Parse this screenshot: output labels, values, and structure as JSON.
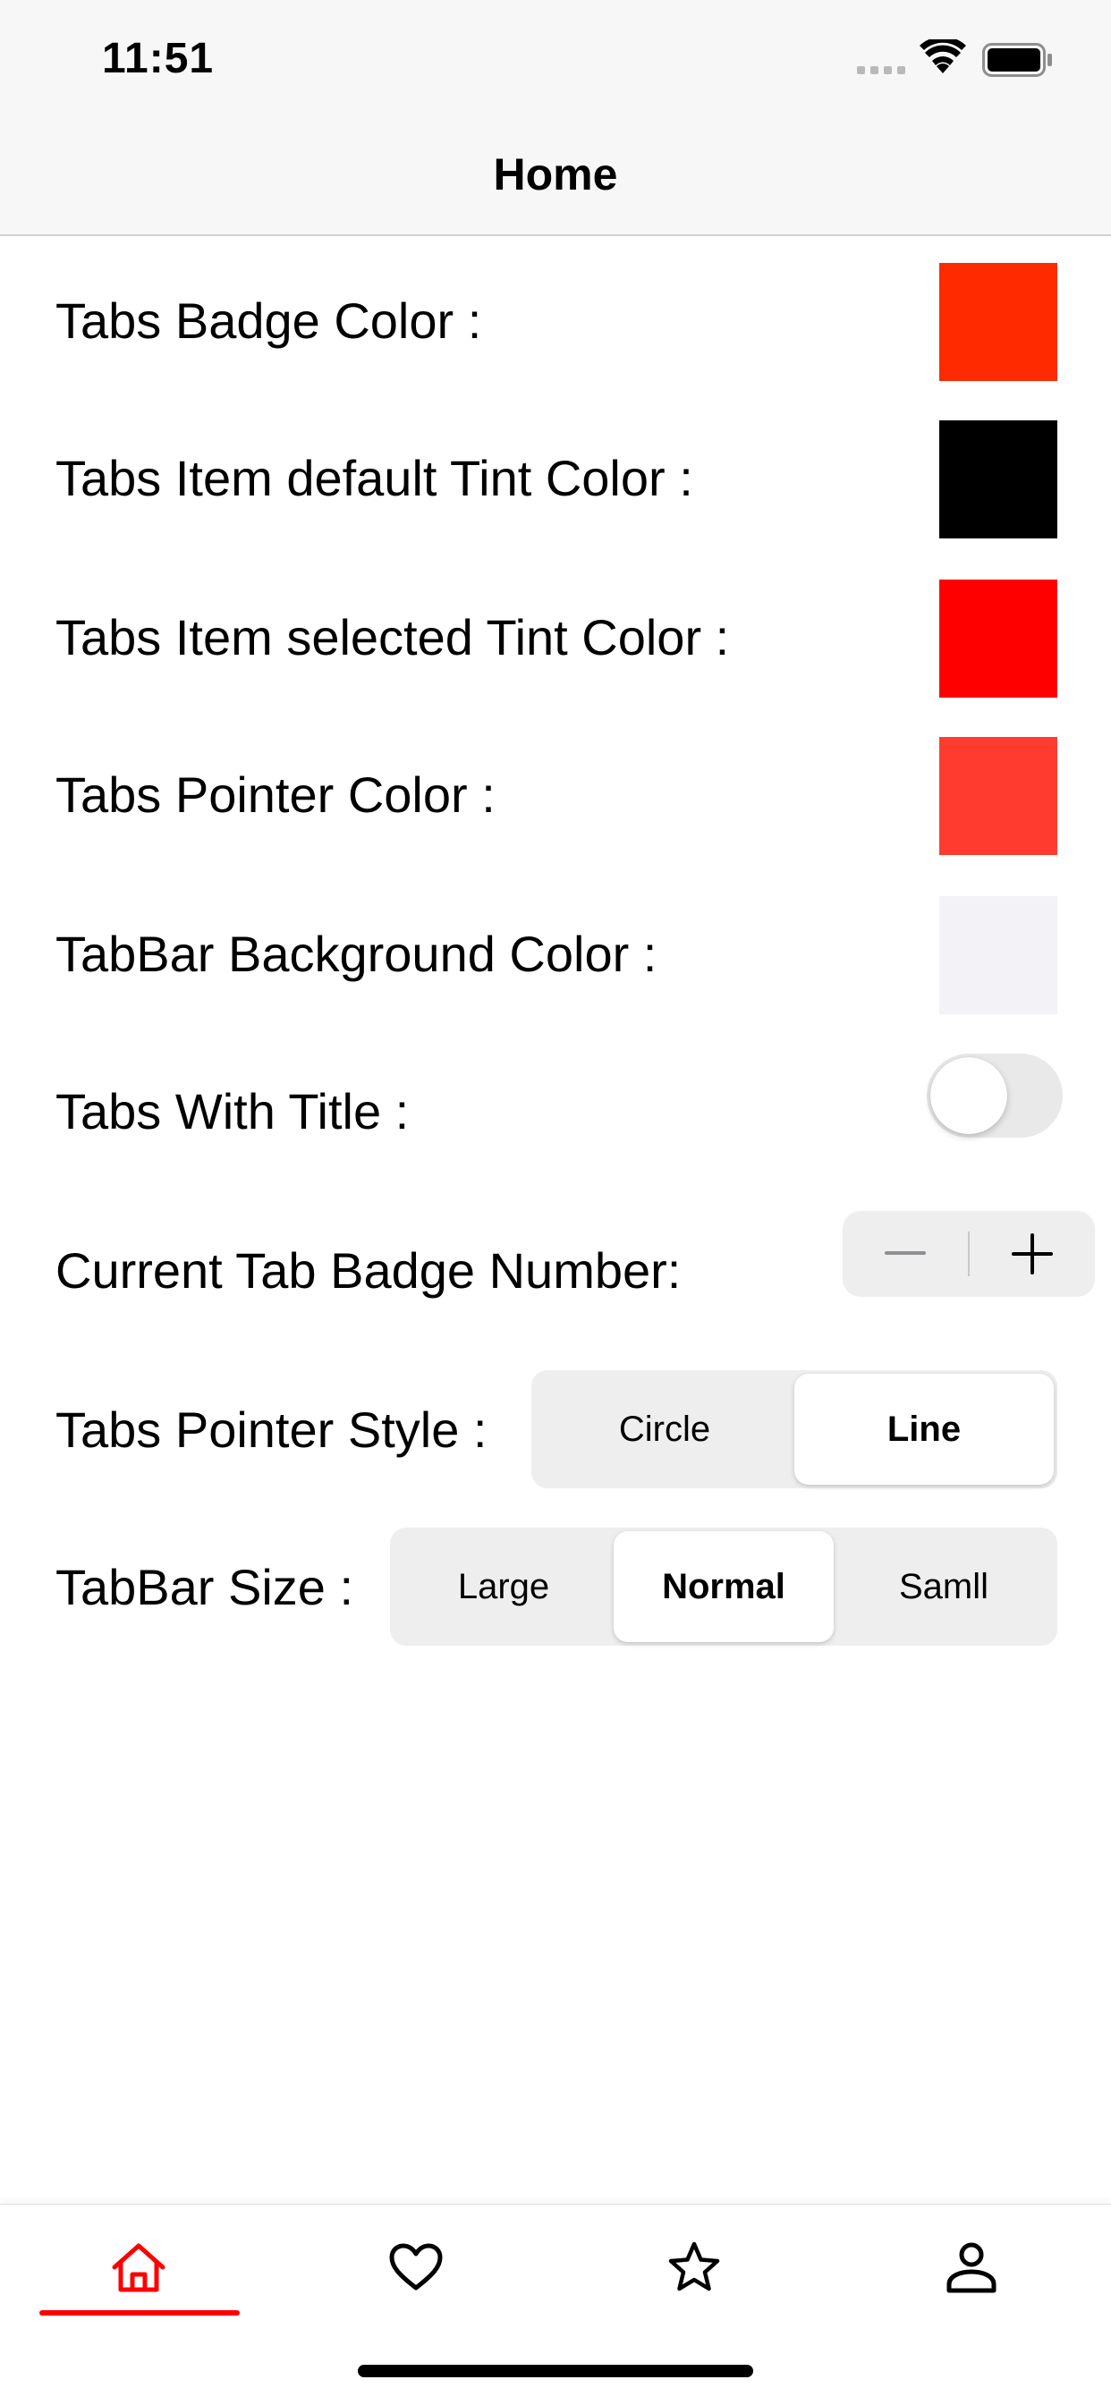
{
  "status_bar": {
    "time": "11:51",
    "icons": [
      "signal-dots-icon",
      "wifi-icon",
      "battery-icon"
    ]
  },
  "nav": {
    "title": "Home"
  },
  "settings": {
    "badge_color": {
      "label": "Tabs Badge Color :",
      "color": "#ff2a00"
    },
    "default_tint": {
      "label": "Tabs Item default Tint Color :",
      "color": "#000000"
    },
    "selected_tint": {
      "label": "Tabs Item selected Tint Color :",
      "color": "#ff0000"
    },
    "pointer_color": {
      "label": "Tabs Pointer Color :",
      "color": "#ff3b30"
    },
    "tabbar_bg": {
      "label": "TabBar Background Color :",
      "color": "#f2f2f7"
    },
    "with_title": {
      "label": "Tabs With Title :",
      "on": false
    },
    "badge_number": {
      "label": "Current Tab Badge Number:",
      "minus": "minus-icon",
      "plus": "plus-icon"
    },
    "pointer_style": {
      "label": "Tabs Pointer Style :",
      "options": [
        "Circle",
        "Line"
      ],
      "selected": "Line"
    },
    "tabbar_size": {
      "label": "TabBar Size :",
      "options": [
        "Large",
        "Normal",
        "Samll"
      ],
      "selected": "Normal"
    }
  },
  "tab_bar": {
    "items": [
      {
        "icon": "home-icon",
        "active": true
      },
      {
        "icon": "heart-icon",
        "active": false
      },
      {
        "icon": "star-icon",
        "active": false
      },
      {
        "icon": "person-icon",
        "active": false
      }
    ],
    "active_color": "#ff0000",
    "inactive_color": "#000000",
    "pointer_color": "#ff0000"
  }
}
